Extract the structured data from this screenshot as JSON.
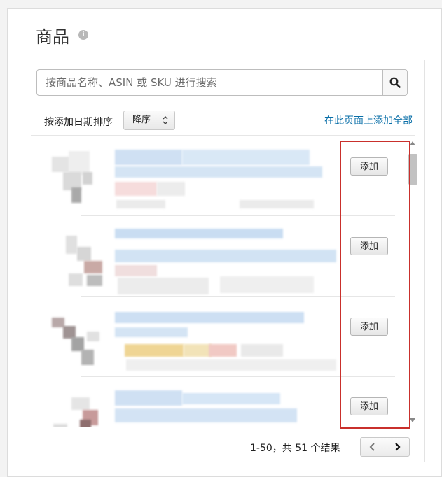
{
  "header": {
    "title": "商品",
    "info_icon": "info-icon"
  },
  "search": {
    "placeholder": "按商品名称、ASIN 或 SKU 进行搜索",
    "button_icon": "search-icon"
  },
  "sort": {
    "label": "按添加日期排序",
    "selected": "降序"
  },
  "add_all_link": "在此页面上添加全部",
  "rows": [
    {
      "add_label": "添加"
    },
    {
      "add_label": "添加"
    },
    {
      "add_label": "添加"
    },
    {
      "add_label": "添加"
    }
  ],
  "pagination": {
    "summary": "1-50，共 51 个结果",
    "prev_icon": "chevron-left-icon",
    "next_icon": "chevron-right-icon"
  },
  "colors": {
    "link": "#0a6fa8",
    "highlight_border": "#c9302c",
    "blurred_title": "#cfe2f6",
    "blurred_detail": "#ececec"
  }
}
